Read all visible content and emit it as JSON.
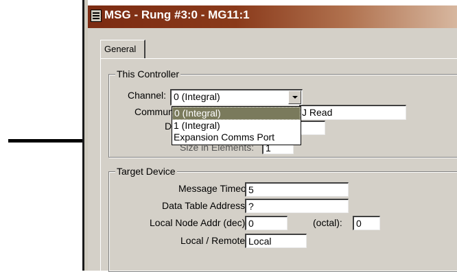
{
  "window": {
    "title": "MSG - Rung #3:0 - MG11:1"
  },
  "tabs": [
    {
      "label": "General"
    }
  ],
  "this_controller": {
    "group_label": "This Controller",
    "channel_label": "Channel:",
    "channel_value": "0 (Integral)",
    "communication_label_partial": "Commun",
    "communication_value_partial": "J Read",
    "d_label_partial": "D",
    "size_label_partial": "Size in Elements:",
    "size_value": "1",
    "dropdown_options": [
      {
        "label": "0 (Integral)",
        "selected": true
      },
      {
        "label": "1 (Integral)",
        "selected": false
      },
      {
        "label": "Expansion Comms Port",
        "selected": false
      }
    ]
  },
  "target_device": {
    "group_label": "Target Device",
    "timeout_label": "Message Timeout :",
    "timeout_value": "5",
    "address_label": "Data Table Address:",
    "address_value": "?",
    "node_label": "Local Node Addr (dec):",
    "node_dec_value": "0",
    "node_octal_label": "(octal):",
    "node_octal_value": "0",
    "local_remote_label": "Local / Remote :",
    "local_remote_value": "Local"
  },
  "colors": {
    "titlebar_start": "#7b2b12",
    "titlebar_end": "#d7b79f",
    "dialog_bg": "#d4d0c8",
    "selected_item_bg": "#7a7a5c"
  },
  "icons": {
    "annotation": "arrow-right-icon",
    "app": "rslogix-app-icon",
    "combo": "chevron-down-icon"
  }
}
